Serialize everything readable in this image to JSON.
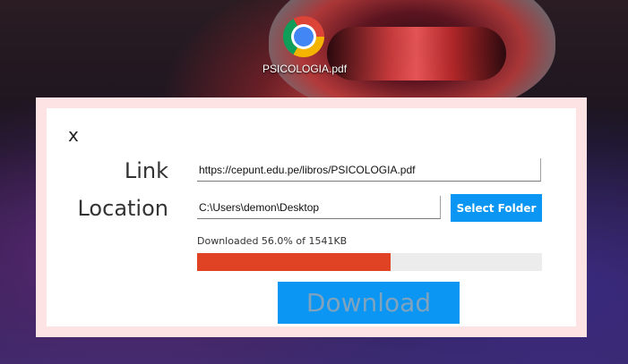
{
  "desktop": {
    "file_icon": "chrome-icon",
    "file_label": "PSICOLOGIA.pdf"
  },
  "dialog": {
    "close_label": "x",
    "link_label": "Link",
    "location_label": "Location",
    "url_value": "https://cepunt.edu.pe/libros/PSICOLOGIA.pdf",
    "location_value": "C:\\Users\\demon\\Desktop",
    "select_folder_label": "Select Folder",
    "status_text": "Downloaded 56.0% of 1541KB",
    "progress_fraction": 0.56,
    "download_label": "Download"
  },
  "colors": {
    "accent_blue": "#0a96f2",
    "progress_red": "#e04324",
    "dialog_border": "#fde3e3"
  }
}
